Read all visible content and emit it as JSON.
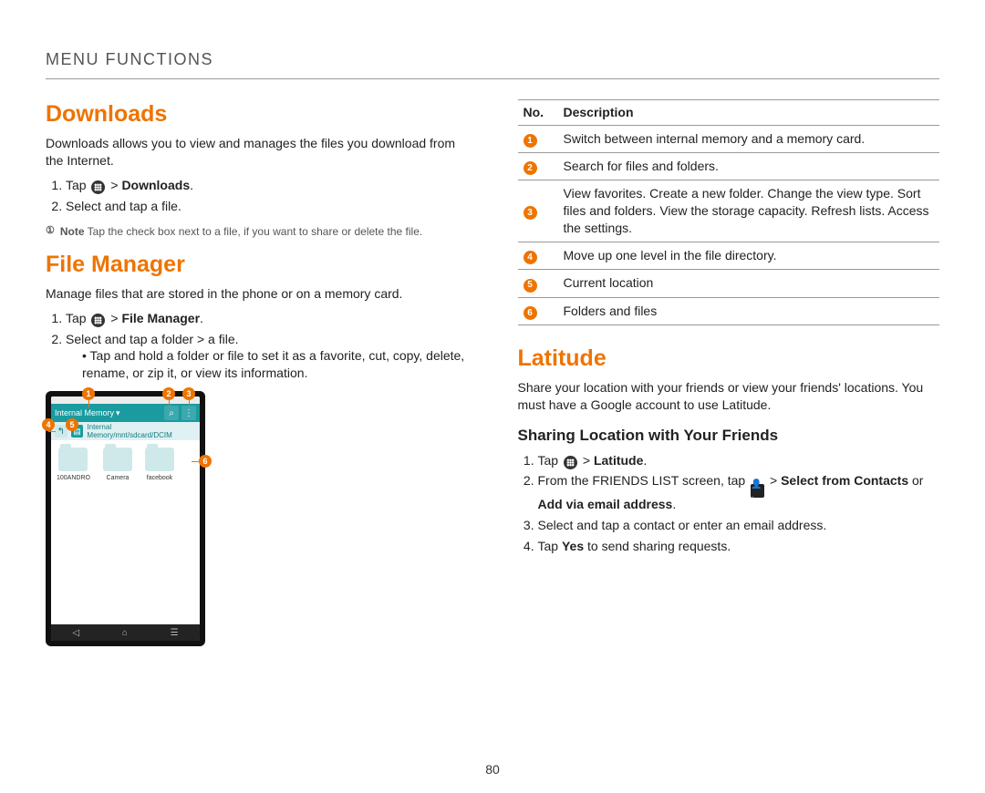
{
  "header": "MENU FUNCTIONS",
  "page_number": "80",
  "left": {
    "downloads": {
      "title": "Downloads",
      "intro": "Downloads allows you to view and manages the files you download from the Internet.",
      "step1_pre": "Tap ",
      "step1_post": " > ",
      "step1_bold": "Downloads",
      "step1_end": ".",
      "step2": "Select and tap a file.",
      "note_label": "Note",
      "note_text": " Tap the check box next to a file, if you want to share or delete the file."
    },
    "filemanager": {
      "title": "File Manager",
      "intro": "Manage files that are stored in the phone or on a memory card.",
      "step1_pre": "Tap ",
      "step1_post": " > ",
      "step1_bold": "File Manager",
      "step1_end": ".",
      "step2": "Select and tap a folder > a file.",
      "bullet": "Tap and hold a folder or file to set it as a favorite, cut, copy, delete, rename, or zip it, or view its information."
    },
    "phone": {
      "mem_label": "Internal Memory",
      "breadcrumb": "Internal Memory/mnt/sdcard/DCIM",
      "folders": [
        "100ANDRO",
        "Camera",
        "facebook"
      ]
    }
  },
  "right": {
    "table": {
      "h_no": "No.",
      "h_desc": "Description",
      "rows": [
        "Switch between internal memory and a memory card.",
        "Search for files and folders.",
        "View favorites. Create a new folder. Change the view type. Sort files and folders. View the storage capacity. Refresh lists. Access the settings.",
        "Move up one level in the file directory.",
        "Current location",
        "Folders and files"
      ]
    },
    "latitude": {
      "title": "Latitude",
      "intro": "Share your location with your friends or view your friends' locations. You must have a Google account to use Latitude.",
      "subhead": "Sharing Location with Your Friends",
      "step1_pre": "Tap ",
      "step1_post": " > ",
      "step1_bold": "Latitude",
      "step1_end": ".",
      "step2_a": "From the FRIENDS LIST screen, tap ",
      "step2_b": " > ",
      "step2_bold1": "Select from Contacts",
      "step2_mid": " or ",
      "step2_bold2": "Add via email address",
      "step2_end": ".",
      "step3": "Select and tap a contact or enter an email address.",
      "step4_a": "Tap ",
      "step4_bold": "Yes",
      "step4_b": " to send sharing requests."
    }
  }
}
